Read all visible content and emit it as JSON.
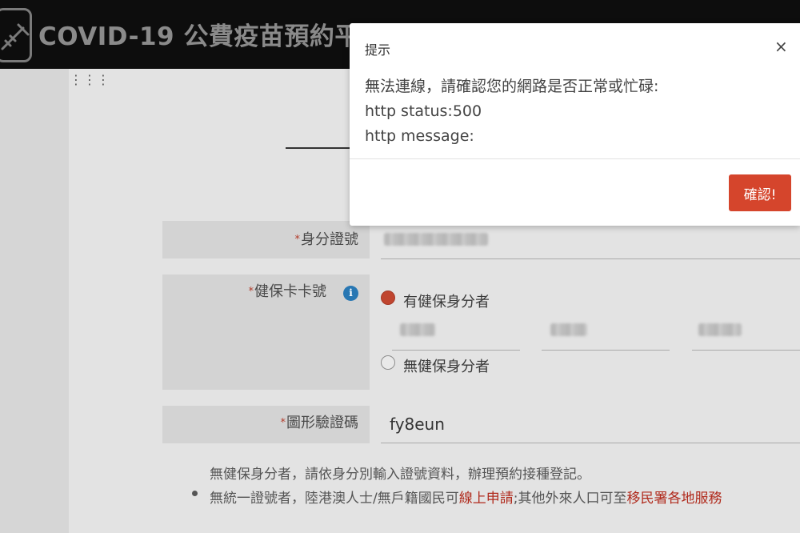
{
  "header": {
    "title": "COVID-19 公費疫苗預約平台"
  },
  "form": {
    "id_label": "身分證號",
    "nhi_label": "健保卡卡號",
    "nhi_option_yes": "有健保身分者",
    "nhi_option_no": "無健保身分者",
    "captcha_label": "圖形驗證碼",
    "captcha_value": "fy8eun",
    "required_mark": "*",
    "info_icon": "i"
  },
  "notes": {
    "line1": "無健保身分者，請依身分別輸入證號資料，辦理預約接種登記。",
    "line2_pre": "無統一證號者，陸港澳人士/無戶籍國民可",
    "line2_link1": "線上申請",
    "line2_mid": ";其他外來人口可至",
    "line2_link2": "移民署各地服務"
  },
  "modal": {
    "title": "提示",
    "close": "×",
    "message_line1": "無法連線，請確認您的網路是否正常或忙碌:",
    "message_line2": "http status:500",
    "message_line3": "http message:",
    "confirm_label": "確認!"
  },
  "colors": {
    "header_bg": "#0d0d0d",
    "accent": "#d5452c",
    "info": "#2877b3"
  }
}
